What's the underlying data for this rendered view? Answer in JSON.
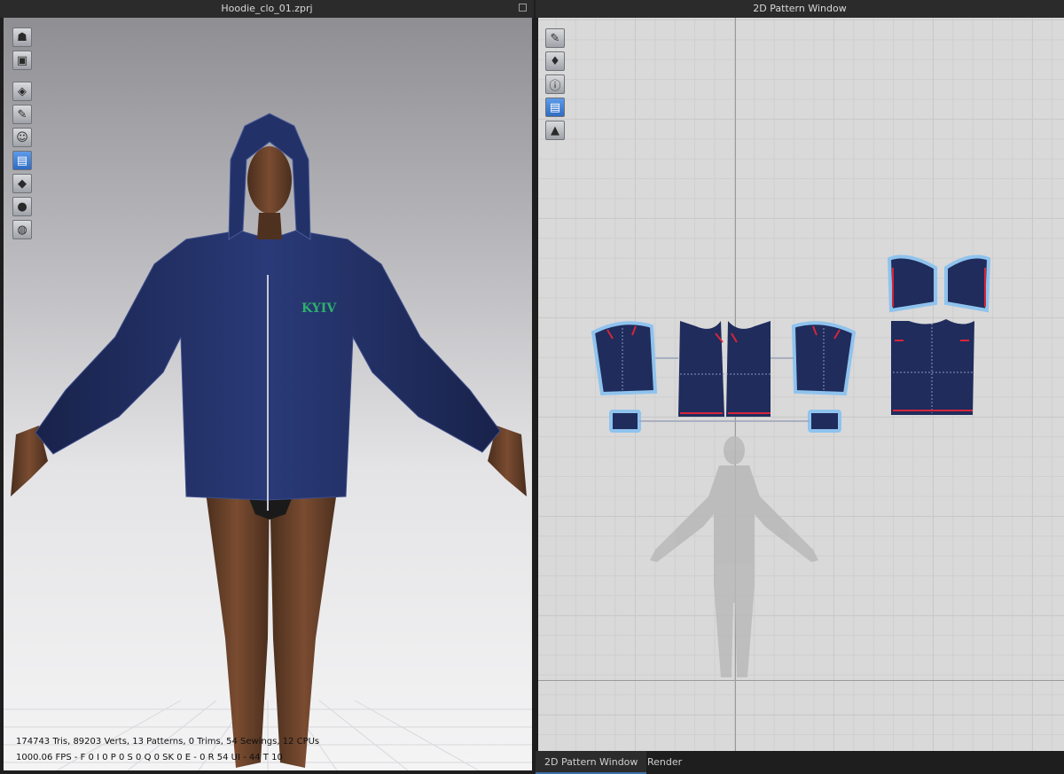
{
  "app": {
    "left_title": "Hoodie_clo_01.zprj",
    "right_title": "2D Pattern Window"
  },
  "viewport3d": {
    "brand_text": "KYIV",
    "stats_line1": "174743 Tris, 89203 Verts, 13 Patterns, 0 Trims, 54 Sewings, 12 CPUs",
    "stats_line2": "1000.06 FPS - F 0 I 0 P 0 S 0 Q 0 SK 0 E - 0 R 54 UI - 44 T 10",
    "toolbar_icons": [
      "avatar-display-icon",
      "garment-display-icon",
      "show-garment-icon",
      "show-fabric-icon",
      "show-avatar-icon",
      "texture-mode-icon",
      "thickness-icon",
      "skin-icon",
      "world-icon"
    ]
  },
  "pattern2d": {
    "toolbar_icons": [
      "edit-pattern-icon",
      "pattern-shirt-icon",
      "info-icon",
      "display-pattern-icon",
      "lock-icon"
    ],
    "colors": {
      "fabric": "#1f2c5c",
      "outline": "#8fc3ee",
      "seam_mark": "#d6253b",
      "grid": "#d9d9d9"
    }
  },
  "tabs": [
    {
      "label": "2D Pattern Window",
      "active": true
    },
    {
      "label": "Render",
      "active": false
    }
  ]
}
